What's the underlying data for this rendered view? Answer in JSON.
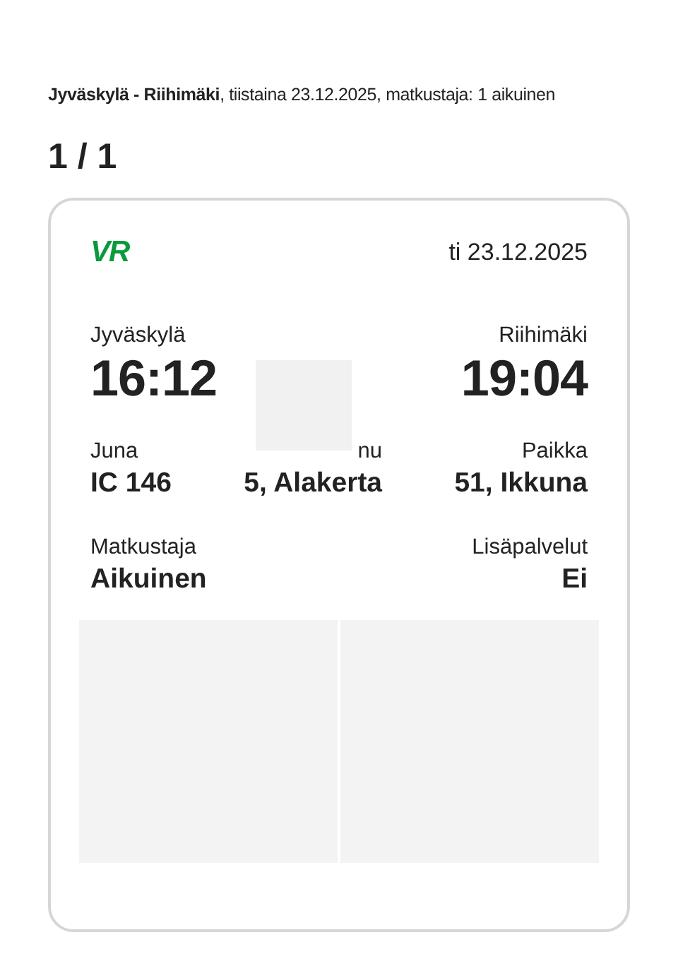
{
  "summary": "**Jyväskylä - Riihimäki**, tiistaina 23.12.2025, matkustaja: 1 aikuinen",
  "counter": "1 / 1",
  "ticket": {
    "logo": "VR",
    "date": "ti 23.12.2025",
    "departure": {
      "station": "Jyväskylä",
      "time": "16:12"
    },
    "arrival": {
      "station": "Riihimäki",
      "time": "19:04"
    },
    "details": [
      [
        {
          "label": "Juna",
          "value": "IC 146"
        },
        {
          "label": "nu",
          "value": "5, Alakerta"
        },
        {
          "label": "Paikka",
          "value": "51, Ikkuna"
        }
      ],
      [
        {
          "label": "Matkustaja",
          "value": "Aikuinen"
        },
        {
          "label": "Lisäpalvelut",
          "value": "Ei"
        }
      ]
    ]
  }
}
